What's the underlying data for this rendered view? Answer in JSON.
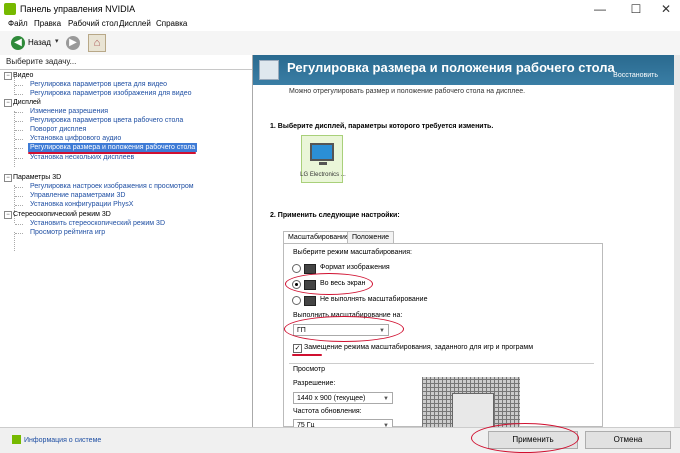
{
  "window": {
    "title": "Панель управления NVIDIA",
    "minimize": "—",
    "maximize": "☐",
    "close": "✕"
  },
  "menu": [
    "Файл",
    "Правка",
    "Рабочий стол",
    "Дисплей",
    "Справка"
  ],
  "toolbar": {
    "back_label": "Назад",
    "dropdown": "▾"
  },
  "left": {
    "header": "Выберите задачу...",
    "tree": [
      {
        "label": "Видео",
        "kind": "cat"
      },
      {
        "label": "Регулировка параметров цвета для видео",
        "kind": "link"
      },
      {
        "label": "Регулировка параметров изображения для видео",
        "kind": "link"
      },
      {
        "label": "Дисплей",
        "kind": "cat"
      },
      {
        "label": "Изменение разрешения",
        "kind": "link"
      },
      {
        "label": "Регулировка параметров цвета рабочего стола",
        "kind": "link"
      },
      {
        "label": "Поворот дисплея",
        "kind": "link"
      },
      {
        "label": "Установка цифрового аудио",
        "kind": "link"
      },
      {
        "label": "Регулировка размера и положения рабочего стола",
        "kind": "selected"
      },
      {
        "label": "Установка нескольких дисплеев",
        "kind": "link"
      },
      {
        "label": "Параметры 3D",
        "kind": "cat"
      },
      {
        "label": "Регулировка настроек изображения с просмотром",
        "kind": "link"
      },
      {
        "label": "Управление параметрами 3D",
        "kind": "link"
      },
      {
        "label": "Установка конфигурации PhysX",
        "kind": "link"
      },
      {
        "label": "Стереоскопический режим 3D",
        "kind": "cat"
      },
      {
        "label": "Установить стереоскопический режим 3D",
        "kind": "link"
      },
      {
        "label": "Просмотр рейтинга игр",
        "kind": "link"
      }
    ]
  },
  "main": {
    "title": "Регулировка размера и положения рабочего стола",
    "restore": "Восстановить",
    "description": "Можно отрегулировать размер и положение рабочего стола на дисплее.",
    "step1": "1. Выберите дисплей, параметры которого требуется изменить.",
    "display_label": "LG Electronics ...",
    "step2": "2. Применить следующие настройки:",
    "tabs": [
      "Масштабирование",
      "Положение"
    ],
    "scaling_mode_label": "Выберите режим масштабирования:",
    "modes": [
      "Формат изображения",
      "Во весь экран",
      "Не выполнять масштабирование"
    ],
    "selected_mode": 1,
    "perform_on_label": "Выполнить масштабирование на:",
    "perform_on_value": "ГП",
    "override_label": "Замещение режима масштабирования, заданного для игр и программ",
    "override_checked": true,
    "preview_label": "Просмотр",
    "resolution_label": "Разрешение:",
    "resolution_value": "1440 x 900 (текущее)",
    "refresh_label": "Частота обновления:",
    "refresh_value": "75 Гц"
  },
  "bottom": {
    "info": "Информация о системе",
    "apply": "Применить",
    "cancel": "Отмена"
  }
}
